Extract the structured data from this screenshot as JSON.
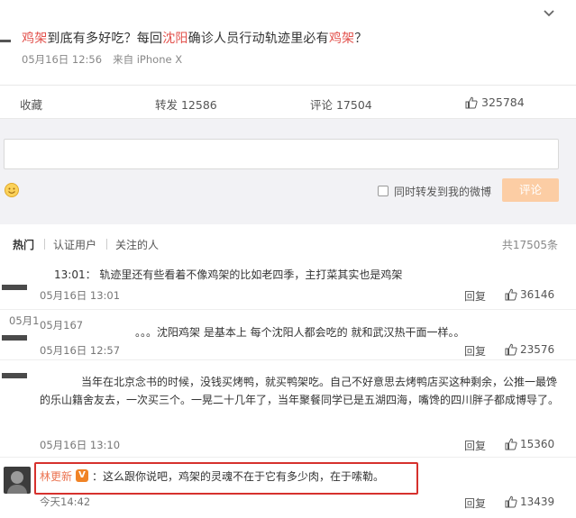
{
  "post": {
    "text_parts": [
      "鸡架",
      "到底有多好吃？每回",
      "沈阳",
      "确诊人员行动轨迹里必有",
      "鸡架",
      "？"
    ],
    "time": "05月16日 12:56",
    "source": "来自 iPhone X"
  },
  "actions": {
    "favorite": "收藏",
    "forward": "转发 12586",
    "comment": "评论 17504",
    "like_count": "325784"
  },
  "comment_box": {
    "also_forward_label": "同时转发到我的微博",
    "submit_label": "评论"
  },
  "filters": {
    "tabs": [
      "热门",
      "认证用户",
      "关注的人"
    ],
    "total": "共17505条"
  },
  "comments": [
    {
      "text": "13:01：   轨迹里还有些看着不像鸡架的比如老四季，主打菜其实也是鸡架",
      "time": "05月16日 13:01",
      "reply": "回复",
      "likes": "36146"
    },
    {
      "prefix": "05月1",
      "time_a": "05月167",
      "text": "。。。沈阳鸡架 是基本上 每个沈阳人都会吃的 就和武汉热干面一样。。",
      "time": "05月16日 12:57",
      "reply": "回复",
      "likes": "23576"
    },
    {
      "text": "当年在北京念书的时候，没钱买烤鸭，就买鸭架吃。自己不好意思去烤鸭店买这种剩余，公推一最馋的乐山籍舍友去，一次买三个。一晃二十几年了，当年聚餐同学已是五湖四海，嘴馋的四川胖子都成博导了。",
      "time": "05月16日 13:10",
      "reply": "回复",
      "likes": "15360"
    },
    {
      "name": "林更新",
      "vip_badge": "V",
      "text": "：这么跟你说吧，鸡架的灵魂不在于它有多少肉，在于嗦勒。",
      "time": "今天14:42",
      "reply": "回复",
      "likes": "13439"
    }
  ],
  "colors": {
    "highlight_red": "#e2504b",
    "submit_orange": "#fccda4",
    "frame_red": "#d6312d",
    "username_orange": "#eb7350"
  },
  "icons": [
    "chevron-down-icon",
    "thumb-up-icon",
    "emoji-icon",
    "checkbox-icon",
    "vip-badge-icon"
  ]
}
